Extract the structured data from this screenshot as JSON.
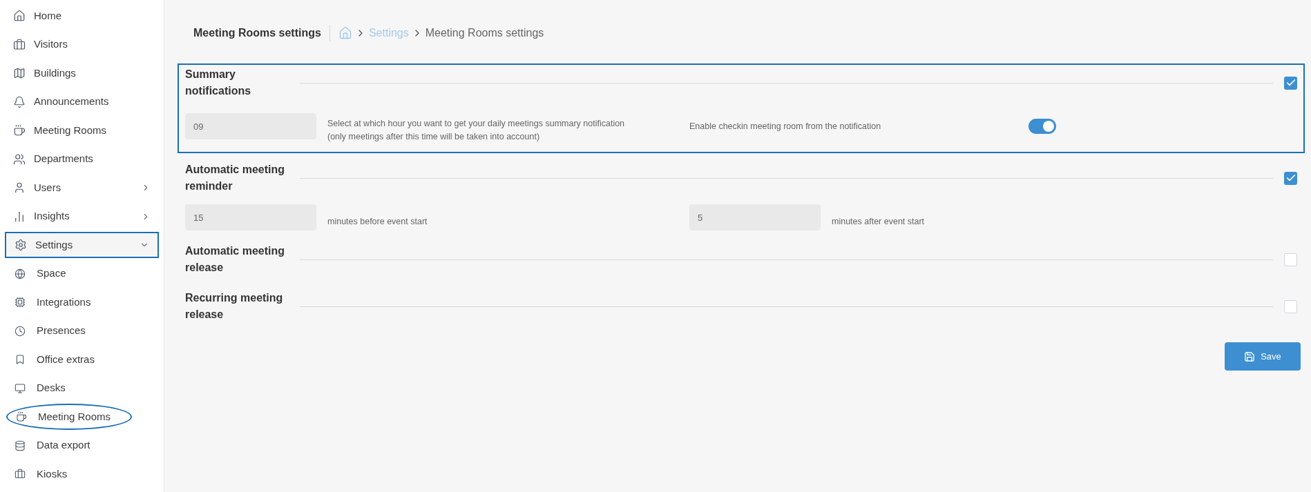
{
  "sidebar": {
    "items": [
      {
        "label": "Home",
        "highlighted": false
      },
      {
        "label": "Visitors",
        "highlighted": false
      },
      {
        "label": "Buildings",
        "highlighted": false
      },
      {
        "label": "Announcements",
        "highlighted": false
      },
      {
        "label": "Meeting Rooms",
        "highlighted": false
      },
      {
        "label": "Departments",
        "highlighted": false
      },
      {
        "label": "Users",
        "highlighted": false,
        "expanded": false
      },
      {
        "label": "Insights",
        "highlighted": false,
        "expanded": false
      },
      {
        "label": "Settings",
        "highlighted": true,
        "expanded": true,
        "children": [
          {
            "label": "Space",
            "highlighted": false
          },
          {
            "label": "Integrations",
            "highlighted": false
          },
          {
            "label": "Presences",
            "highlighted": false
          },
          {
            "label": "Office extras",
            "highlighted": false
          },
          {
            "label": "Desks",
            "highlighted": false
          },
          {
            "label": "Meeting Rooms",
            "highlighted": true
          },
          {
            "label": "Data export",
            "highlighted": false
          },
          {
            "label": "Kiosks",
            "highlighted": false
          }
        ]
      }
    ]
  },
  "header": {
    "title": "Meeting Rooms settings",
    "breadcrumb": [
      {
        "label": "Settings",
        "kind": "link"
      },
      {
        "label": "Meeting Rooms settings",
        "kind": "current"
      }
    ]
  },
  "sections": [
    {
      "title": "Summary notifications",
      "checked": true,
      "highlighted": true,
      "fields": [
        {
          "kind": "input",
          "value": "09",
          "label_lines": [
            "Select at which hour you want to get your daily meetings summary notification",
            "(only meetings after this time will be taken into account)"
          ]
        },
        {
          "kind": "toggle",
          "label": "Enable checkin meeting room from the notification",
          "on": true
        }
      ]
    },
    {
      "title": "Automatic meeting reminder",
      "checked": true,
      "highlighted": false,
      "fields": [
        {
          "kind": "input",
          "value": "15",
          "label_lines": [
            "minutes before event start"
          ]
        },
        {
          "kind": "input",
          "value": "5",
          "label_lines": [
            "minutes after event start"
          ]
        }
      ]
    },
    {
      "title": "Automatic meeting release",
      "checked": false,
      "highlighted": false
    },
    {
      "title": "Recurring meeting release",
      "checked": false,
      "highlighted": false
    }
  ],
  "save_button": {
    "label": "Save"
  }
}
